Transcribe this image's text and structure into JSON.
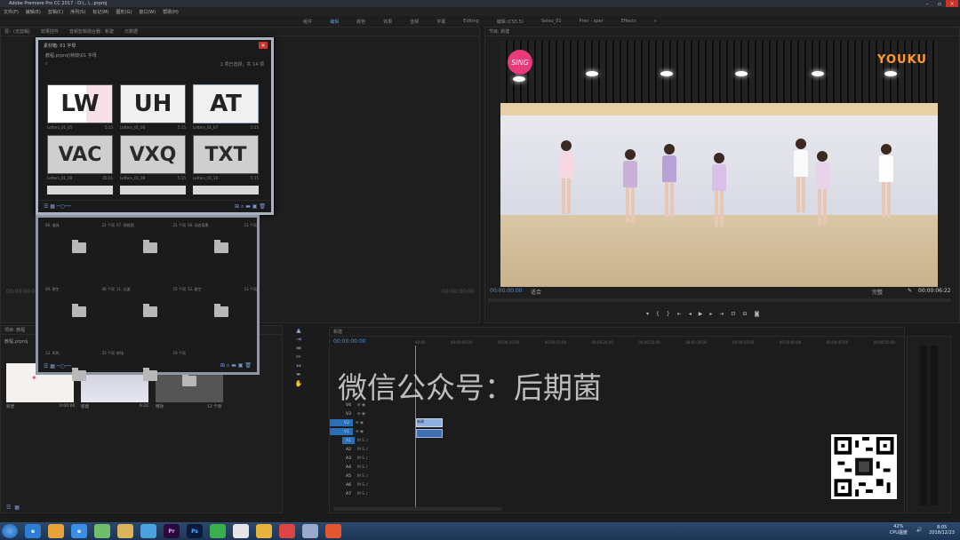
{
  "window": {
    "title": "Adobe Premiere Pro CC 2017 - D:\\...\\...prproj"
  },
  "menu": [
    "文件(F)",
    "编辑(E)",
    "剪辑(C)",
    "序列(S)",
    "标记(M)",
    "图形(G)",
    "窗口(W)",
    "帮助(H)"
  ],
  "workspaces": {
    "items": [
      "组件",
      "编辑",
      "颜色",
      "效果",
      "音频",
      "字幕",
      "Editing",
      "编辑 (CS5.5)",
      "Seleu_01",
      "Prev - xper",
      "Effects"
    ],
    "active_index": 1
  },
  "source_tabs": [
    "源：(无剪辑)",
    "效果控件",
    "音频剪辑混合器：新建",
    "元数据"
  ],
  "library": {
    "header": "素材箱: 01 字母",
    "path": "教程.prproj\\特效\\01 字母",
    "count": "1 项已选择，共 14 项",
    "items": [
      {
        "glyph": "LW",
        "name": "Letters_01_05",
        "dur": "5:15"
      },
      {
        "glyph": "UH",
        "name": "Letters_01_06",
        "dur": "5:15"
      },
      {
        "glyph": "AT",
        "name": "Letters_01_07",
        "dur": "5:15"
      },
      {
        "glyph": "VAC",
        "name": "Letters_01_08",
        "dur": "05:01"
      },
      {
        "glyph": "VXQ",
        "name": "Letters_01_09",
        "dur": "5:15"
      },
      {
        "glyph": "TXT",
        "name": "Letters_01_10",
        "dur": "5:15"
      }
    ]
  },
  "bin": {
    "items": [
      {
        "name": "06. 道具",
        "count": "22 个项"
      },
      {
        "name": "07. 线框图",
        "count": "21 个项"
      },
      {
        "name": "08. 动态背景",
        "count": "12 个项"
      },
      {
        "name": "09. 原生",
        "count": "46 个项"
      },
      {
        "name": "11. 过渡",
        "count": "15 个项"
      },
      {
        "name": "12. 星空",
        "count": "13 个项"
      },
      {
        "name": "13. 叫叫",
        "count": "33 个项"
      },
      {
        "name": "转场",
        "count": "19 个项"
      }
    ]
  },
  "program": {
    "tab": "节目: 新建",
    "timecode_left": "00:00:00:00",
    "fit": "适合",
    "quality": "完整",
    "timecode_right": "00:00:06:22",
    "overlay_logo_left": "SING",
    "overlay_logo_right": "YOUKU"
  },
  "source_timecodes": {
    "left": "00:00:00:00",
    "right": "00:00:00:00"
  },
  "project": {
    "tab": "项目: 教程",
    "path": "教程.prproj",
    "items": [
      {
        "name": "新建",
        "dur": "0:00:00"
      },
      {
        "name": "新建",
        "dur": "6:22"
      },
      {
        "name": "特效",
        "dur": "13 个项"
      }
    ]
  },
  "timeline": {
    "tab": "新建",
    "timecode": "00:00:00:00",
    "ruler": [
      "00:00",
      "00:00:05:00",
      "00:00:10:00",
      "00:00:15:00",
      "00:00:20:00",
      "00:00:25:00",
      "00:00:30:00",
      "00:00:35:00",
      "00:00:40:00",
      "00:00:45:00",
      "00:00:50:00"
    ],
    "video_tracks": [
      "V4",
      "V3",
      "V2",
      "V1"
    ],
    "audio_tracks": [
      "A1",
      "A2",
      "A3",
      "A4",
      "A5",
      "A6",
      "A7"
    ],
    "clip_label": "新建"
  },
  "watermark": "微信公众号：后期菌",
  "taskbar": {
    "apps": [
      "e",
      "",
      "e",
      "",
      "",
      "",
      "Pr",
      "Ps",
      "",
      "",
      "",
      "",
      "",
      ""
    ],
    "tray": {
      "cpu": "42%\nCPU温度",
      "time": "8:05",
      "date": "2018/12/23"
    }
  },
  "colors": {
    "accent": "#4f8fe0",
    "track_on": "#2a6fb8",
    "qr_bg": "#ffffff"
  }
}
